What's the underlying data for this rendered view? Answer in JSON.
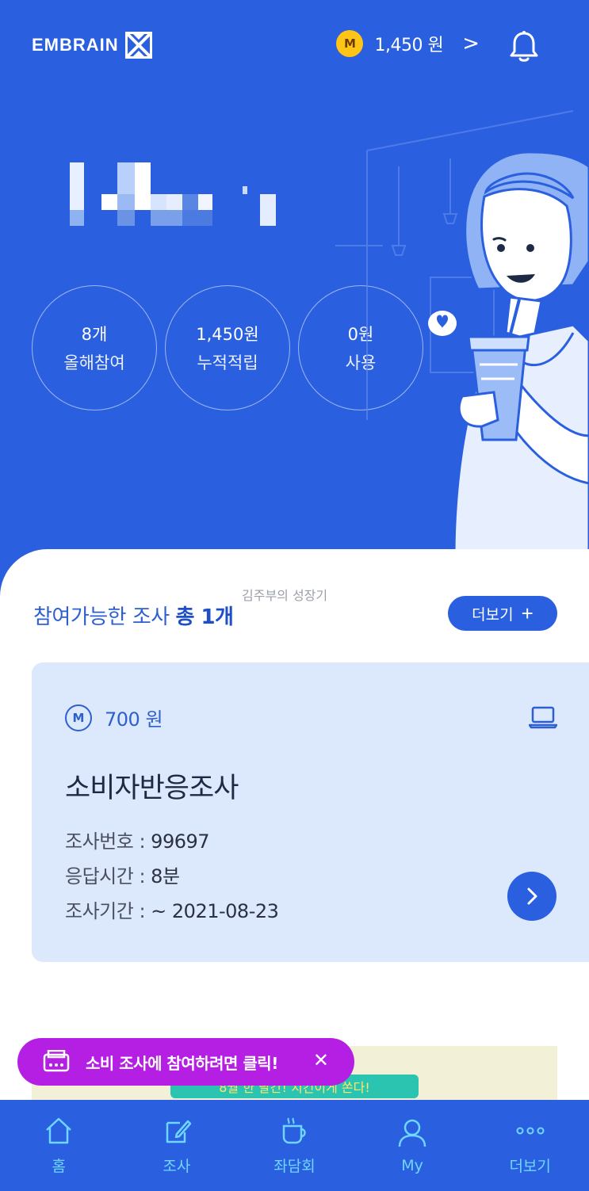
{
  "header": {
    "brand": "EMBRAIN",
    "coin_symbol": "M",
    "points": "1,450 원",
    "chevron": ">"
  },
  "stats": [
    {
      "value": "8개",
      "label": "올해참여"
    },
    {
      "value": "1,450원",
      "label": "누적적립"
    },
    {
      "value": "0원",
      "label": "사용"
    }
  ],
  "watermark": "김주부의 성장기",
  "section": {
    "title_prefix": "참여가능한 조사",
    "title_count": "총 1개",
    "more_label": "더보기",
    "more_plus": "+"
  },
  "survey": {
    "coin_symbol": "M",
    "reward": "700 원",
    "title": "소비자반응조사",
    "meta": [
      {
        "key": "조사번호 : ",
        "value": "99697"
      },
      {
        "key": "응답시간 : ",
        "value": "8분"
      },
      {
        "key": "조사기간 : ",
        "value": "~ 2021-08-23"
      }
    ]
  },
  "banner": {
    "text": "8월 한 달간! 치킨이게 쏜다!"
  },
  "toast": {
    "text": "소비 조사에 참여하려면 클릭!",
    "close": "✕"
  },
  "nav": [
    {
      "icon": "home-icon",
      "label": "홈"
    },
    {
      "icon": "survey-icon",
      "label": "조사"
    },
    {
      "icon": "cup-icon",
      "label": "좌담회"
    },
    {
      "icon": "user-icon",
      "label": "My"
    },
    {
      "icon": "more-icon",
      "label": "더보기"
    }
  ],
  "colors": {
    "primary": "#2a5fe0",
    "card_bg": "#dce8fb",
    "coin": "#ffc516",
    "toast": "#b51fe3",
    "nav_text": "#6fd7ff"
  }
}
